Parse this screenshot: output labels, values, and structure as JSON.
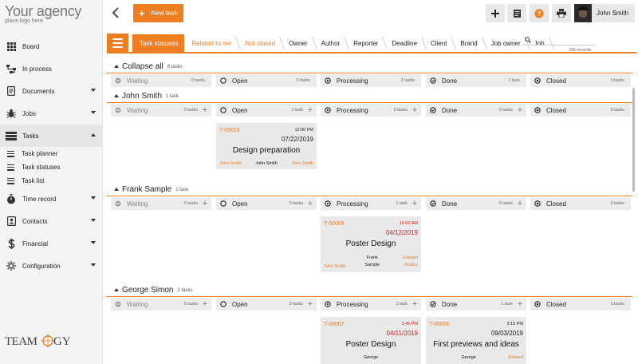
{
  "sidebar": {
    "logo_title": "Your agency",
    "logo_subtitle": "place logo here",
    "items": [
      {
        "label": "Board",
        "icon": "grid-icon"
      },
      {
        "label": "In process",
        "icon": "flow-icon"
      },
      {
        "label": "Documents",
        "icon": "document-icon"
      },
      {
        "label": "Jobs",
        "icon": "bug-icon"
      },
      {
        "label": "Tasks",
        "icon": "list-icon"
      },
      {
        "label": "Time record",
        "icon": "stopwatch-icon"
      },
      {
        "label": "Contacts",
        "icon": "contact-card-icon"
      },
      {
        "label": "Financial",
        "icon": "dollar-icon"
      },
      {
        "label": "Configuration",
        "icon": "gear-icon"
      }
    ],
    "sub_items": [
      {
        "label": "Task planner"
      },
      {
        "label": "Task statuses"
      },
      {
        "label": "Task list"
      }
    ],
    "brand_logo": "TEAMOGY"
  },
  "topbar": {
    "new_task_label": "New task",
    "user_name": "John Smith"
  },
  "filters": {
    "crumbs": [
      {
        "label": "Task statuses"
      },
      {
        "label": "Related to me"
      },
      {
        "label": "Not closed"
      },
      {
        "label": "Owner"
      },
      {
        "label": "Author"
      },
      {
        "label": "Reporter"
      },
      {
        "label": "Deadline"
      },
      {
        "label": "Client"
      },
      {
        "label": "Brand"
      },
      {
        "label": "Job owner"
      },
      {
        "label": "Job"
      }
    ],
    "records": "8/8 records"
  },
  "board": {
    "groups": [
      {
        "name": "Collapse all",
        "count": "8 tasks",
        "cols": [
          {
            "name": "Waiting",
            "count": "0 tasks"
          },
          {
            "name": "Open",
            "count": "5 tasks"
          },
          {
            "name": "Processing",
            "count": "2 tasks"
          },
          {
            "name": "Done",
            "count": "1 task"
          },
          {
            "name": "Closed",
            "count": "0 tasks"
          }
        ]
      },
      {
        "name": "John Smith",
        "count": "1 task",
        "cols": [
          {
            "name": "Waiting",
            "count": "0 tasks"
          },
          {
            "name": "Open",
            "count": "1 task"
          },
          {
            "name": "Processing",
            "count": "0 tasks"
          },
          {
            "name": "Done",
            "count": "0 tasks"
          },
          {
            "name": "Closed",
            "count": "0 tasks"
          }
        ]
      },
      {
        "name": "Frank Sample",
        "count": "1 task",
        "cols": [
          {
            "name": "Waiting",
            "count": "0 tasks"
          },
          {
            "name": "Open",
            "count": "0 tasks"
          },
          {
            "name": "Processing",
            "count": "1 task"
          },
          {
            "name": "Done",
            "count": "0 tasks"
          },
          {
            "name": "Closed",
            "count": "0 tasks"
          }
        ]
      },
      {
        "name": "George Simon",
        "count": "2 tasks",
        "cols": [
          {
            "name": "Waiting",
            "count": "0 tasks"
          },
          {
            "name": "Open",
            "count": "0 tasks"
          },
          {
            "name": "Processing",
            "count": "1 task"
          },
          {
            "name": "Done",
            "count": "1 task"
          },
          {
            "name": "Closed",
            "count": "0 tasks"
          }
        ]
      }
    ],
    "cards": [
      {
        "id": "T-00016",
        "time": "12:00 PM",
        "date": "07/22/2019",
        "title": "Design preparation",
        "p1": "John Smith",
        "p2": "John Smith",
        "p3": "John Smith"
      },
      {
        "id": "T-00008",
        "time": "10:00 AM",
        "date": "04/12/2019",
        "title": "Poster Design",
        "p1": "John Smith",
        "p2": "Frank Sample",
        "p3": "Edward Rusley"
      },
      {
        "id": "T-00007",
        "time": "3:45 PM",
        "date": "04/11/2019",
        "title": "Poster Design",
        "p2": "George"
      },
      {
        "id": "T-00006",
        "time": "3:15 PM",
        "date": "09/03/2019",
        "title": "First previews and ideas",
        "p2": "George",
        "p3": "Edward"
      }
    ]
  }
}
